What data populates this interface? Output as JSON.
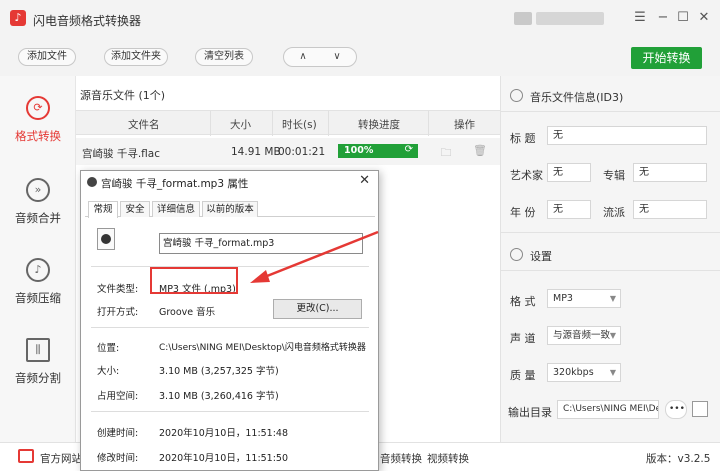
{
  "app": {
    "title": "闪电音频格式转换器",
    "window_controls": {
      "menu": "☰",
      "minimize": "−",
      "maximize": "☐",
      "close": "✕"
    }
  },
  "toolbar": {
    "add_file": "添加文件",
    "add_folder": "添加文件夹",
    "clear_list": "清空列表",
    "move_up": "∧",
    "move_down": "∨",
    "start": "开始转换"
  },
  "sidebar": {
    "items": [
      {
        "label": "格式转换",
        "icon": "refresh-icon",
        "active": true
      },
      {
        "label": "音频合并",
        "icon": "merge-icon",
        "active": false
      },
      {
        "label": "音频压缩",
        "icon": "compress-icon",
        "active": false
      },
      {
        "label": "音频分割",
        "icon": "split-icon",
        "active": false
      }
    ]
  },
  "file_list": {
    "title": "源音乐文件 (1个)",
    "columns": [
      "文件名",
      "大小",
      "时长(s)",
      "转换进度",
      "操作"
    ],
    "rows": [
      {
        "name": "宫崎骏 千寻.flac",
        "size": "14.91 MB",
        "duration": "00:01:21",
        "progress": "100%",
        "progress_value": 1.0
      }
    ]
  },
  "id3": {
    "title": "音乐文件信息(ID3)",
    "fields": [
      {
        "label": "标 题",
        "value": "无"
      },
      {
        "label": "艺术家",
        "value": "无"
      },
      {
        "label": "专辑",
        "value": "无"
      },
      {
        "label": "年 份",
        "value": "无"
      },
      {
        "label": "流派",
        "value": "无"
      }
    ]
  },
  "settings": {
    "title": "设置",
    "format": {
      "label": "格 式",
      "value": "MP3"
    },
    "channel": {
      "label": "声 道",
      "value": "与源音频一致"
    },
    "quality": {
      "label": "质 量",
      "value": "320kbps"
    },
    "output": {
      "label": "输出目录",
      "value": "C:\\Users\\NING MEI\\De"
    }
  },
  "footer": {
    "website": "官方网站",
    "video_convert_a": "音频转换",
    "video_convert_b": "视频转换",
    "version": "版本：v3.2.5"
  },
  "dialog": {
    "title": "宫崎骏 千寻_format.mp3 属性",
    "close": "✕",
    "tabs": [
      "常规",
      "安全",
      "详细信息",
      "以前的版本"
    ],
    "file_name": "宫崎骏 千寻_format.mp3",
    "file_type_label": "文件类型:",
    "file_type_value": "MP3 文件 (.mp3)",
    "open_with_label": "打开方式:",
    "open_with_value": "Groove 音乐",
    "change_button": "更改(C)...",
    "location_label": "位置:",
    "location_value": "C:\\Users\\NING MEI\\Desktop\\闪电音频格式转换器",
    "size_label": "大小:",
    "size_value": "3.10 MB (3,257,325 字节)",
    "disk_label": "占用空间:",
    "disk_value": "3.10 MB (3,260,416 字节)",
    "created_label": "创建时间:",
    "created_value": "2020年10月10日，11:51:48",
    "modified_label": "修改时间:",
    "modified_value": "2020年10月10日，11:51:50"
  },
  "colors": {
    "accent_red": "#e53935",
    "green": "#21a038"
  }
}
